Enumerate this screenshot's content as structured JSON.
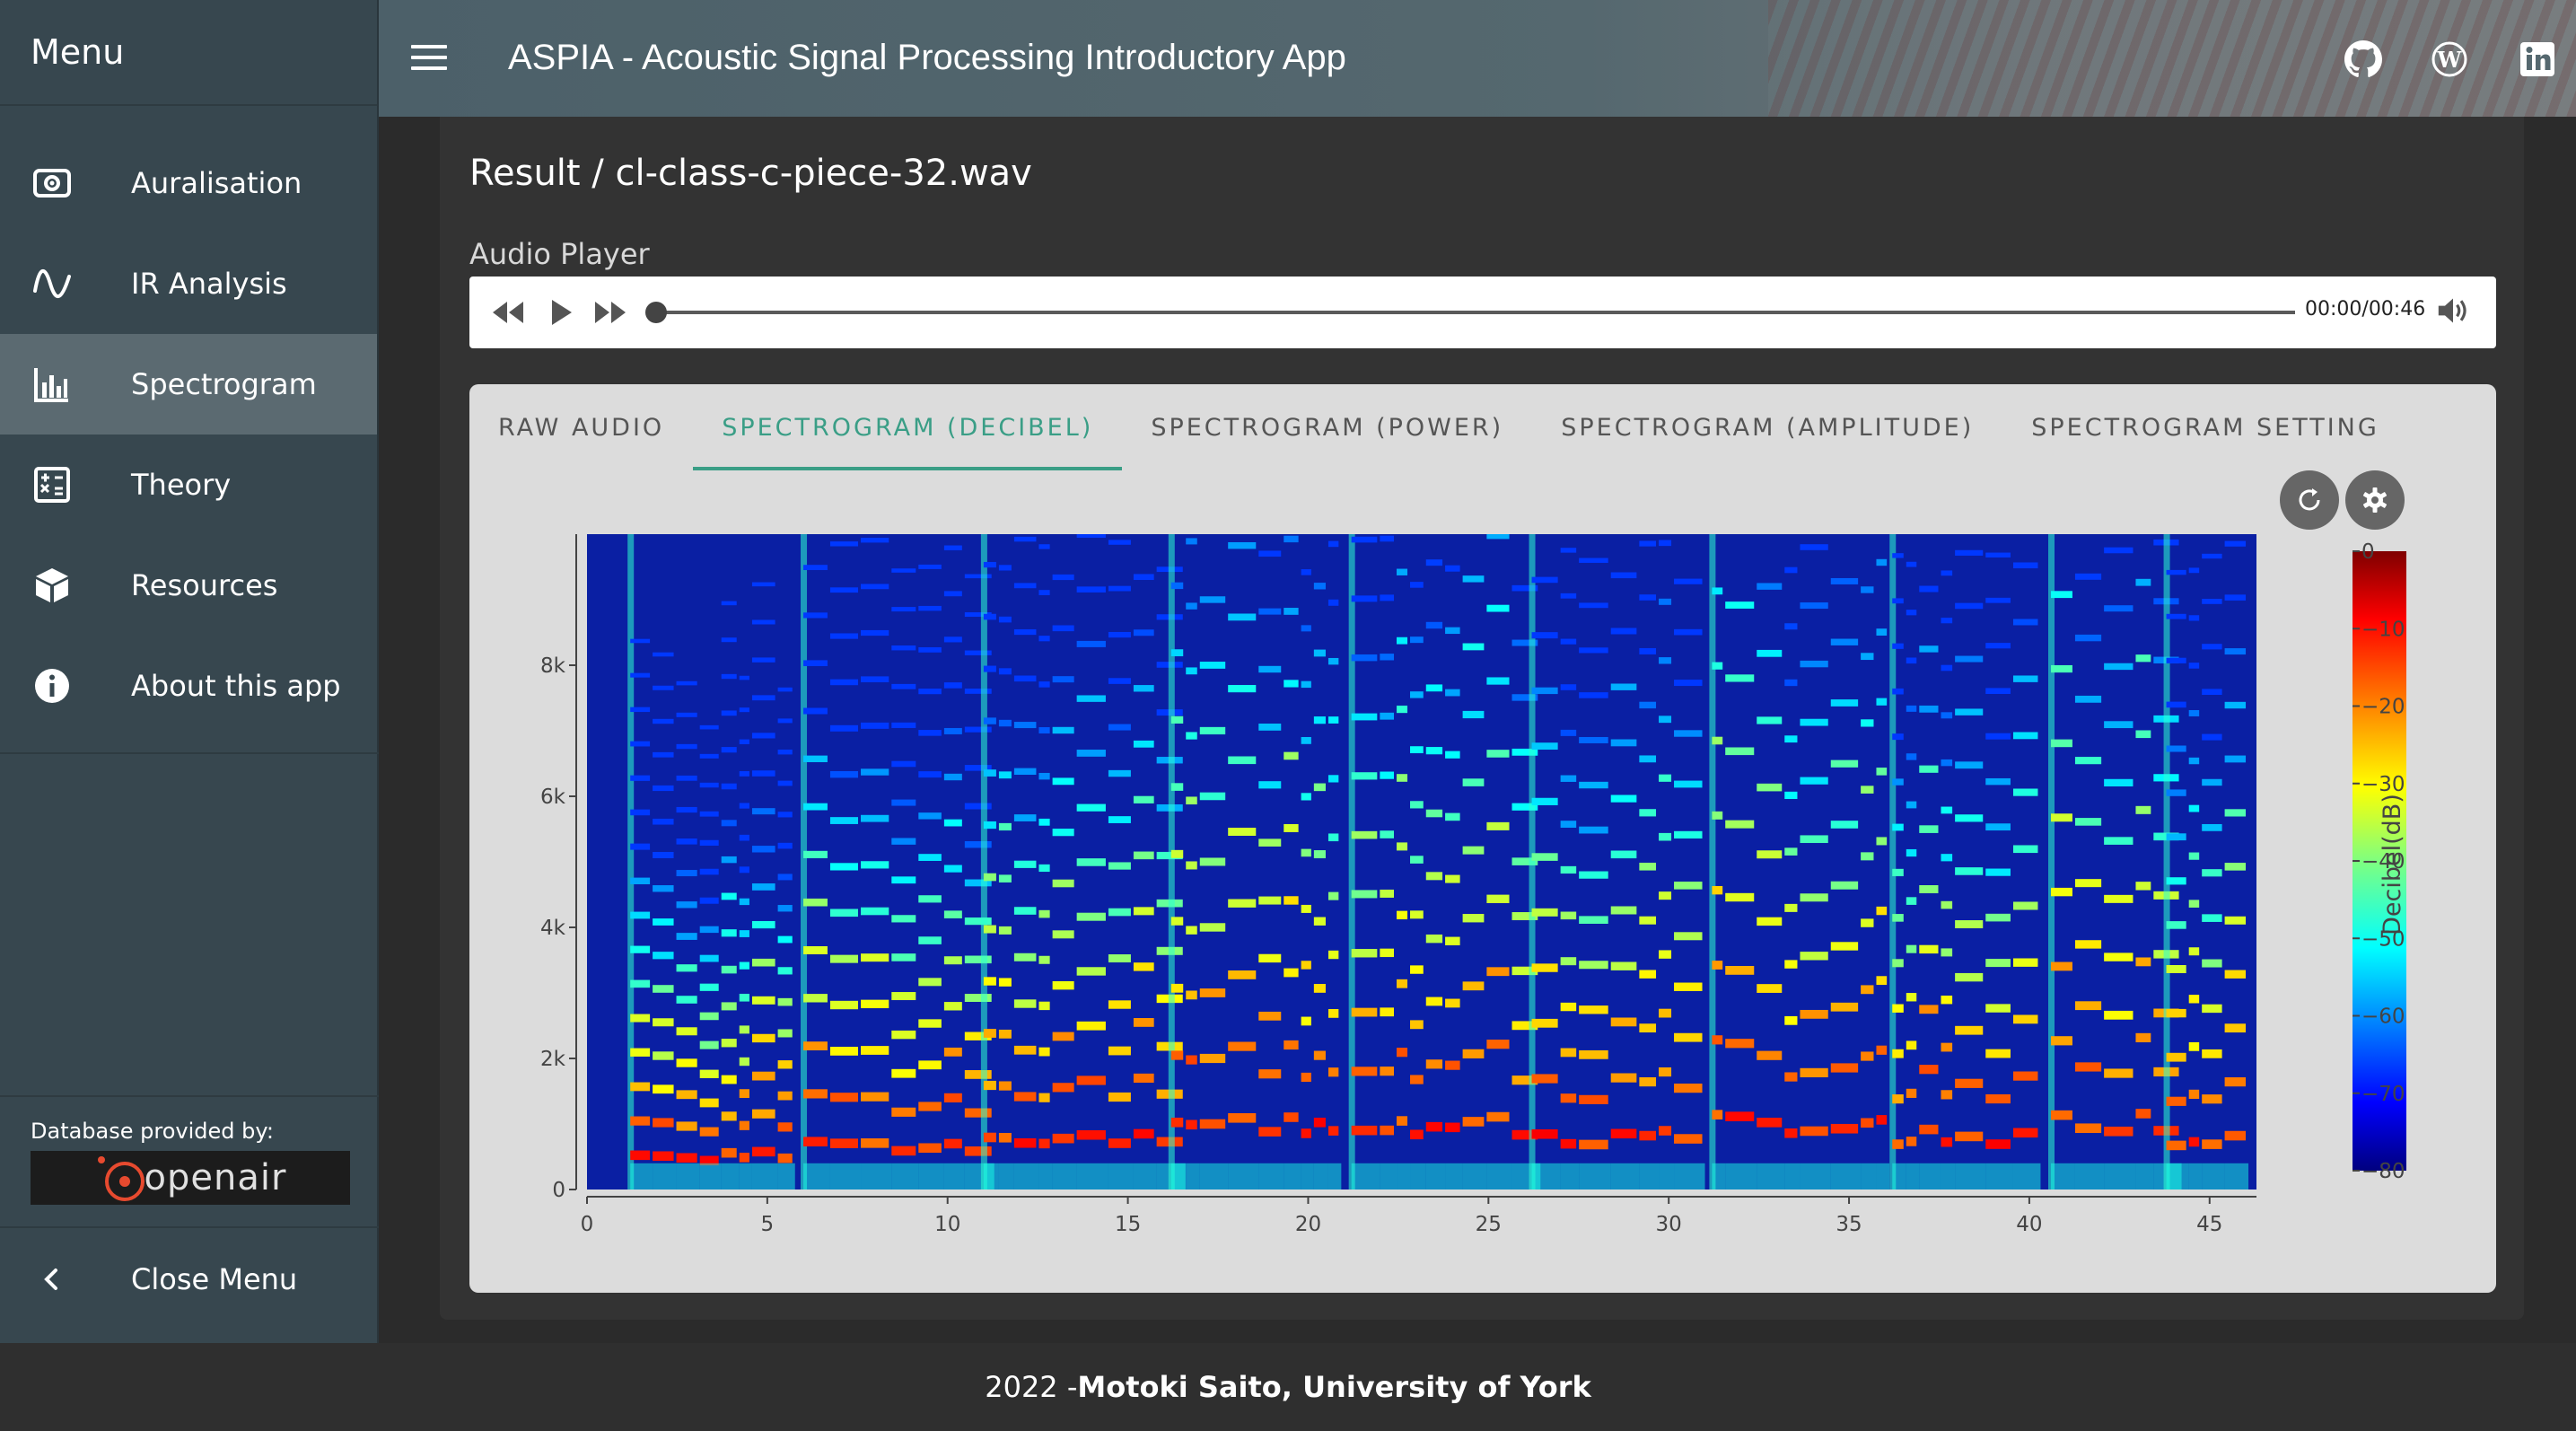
{
  "sidebar": {
    "title": "Menu",
    "items": [
      {
        "label": "Auralisation",
        "icon": "speaker-icon",
        "active": false
      },
      {
        "label": "IR Analysis",
        "icon": "waveform-icon",
        "active": false
      },
      {
        "label": "Spectrogram",
        "icon": "bar-chart-icon",
        "active": true
      },
      {
        "label": "Theory",
        "icon": "calculator-icon",
        "active": false
      },
      {
        "label": "Resources",
        "icon": "cube-icon",
        "active": false
      },
      {
        "label": "About this app",
        "icon": "info-icon",
        "active": false
      }
    ],
    "database_label": "Database provided by:",
    "logo_text": "openair",
    "close_label": "Close Menu"
  },
  "header": {
    "title": "ASPIA - Acoustic Signal Processing Introductory App",
    "icons": [
      "github-icon",
      "wordpress-icon",
      "linkedin-icon"
    ]
  },
  "result": {
    "title": "Result / cl-class-c-piece-32.wav",
    "audio_label": "Audio Player",
    "time": "00:00/00:46",
    "progress": 0.0
  },
  "tabs": [
    {
      "label": "RAW AUDIO",
      "active": false
    },
    {
      "label": "SPECTROGRAM (DECIBEL)",
      "active": true
    },
    {
      "label": "SPECTROGRAM (POWER)",
      "active": false
    },
    {
      "label": "SPECTROGRAM (AMPLITUDE)",
      "active": false
    },
    {
      "label": "SPECTROGRAM SETTING",
      "active": false
    }
  ],
  "chart_data": {
    "type": "heatmap",
    "title": "",
    "xlabel": "",
    "ylabel": "",
    "colorbar_label": "Decibel(dB)",
    "xlim": [
      0,
      46.3
    ],
    "ylim": [
      0,
      10000
    ],
    "x_ticks": [
      0,
      5,
      10,
      15,
      20,
      25,
      30,
      35,
      40,
      45
    ],
    "y_ticks": [
      0,
      2000,
      4000,
      6000,
      8000
    ],
    "y_tick_labels": [
      "0",
      "2k",
      "4k",
      "6k",
      "8k"
    ],
    "colorbar_range": [
      -80,
      0
    ],
    "colorbar_ticks": [
      "0",
      "−10",
      "−20",
      "−30",
      "−40",
      "−50",
      "−60",
      "−70",
      "−80"
    ],
    "colorscale": "jet",
    "note_onsets_s": [
      1.2,
      6.0,
      11.0,
      16.2,
      21.2,
      26.2,
      31.2,
      36.2,
      40.6,
      43.8
    ],
    "fundamental_hz": [
      500,
      680,
      720,
      1000,
      930,
      780,
      1000,
      780,
      1000,
      750
    ],
    "grid": false
  },
  "footer": {
    "year": "2022 - ",
    "author": "Motoki Saito, University of York"
  }
}
